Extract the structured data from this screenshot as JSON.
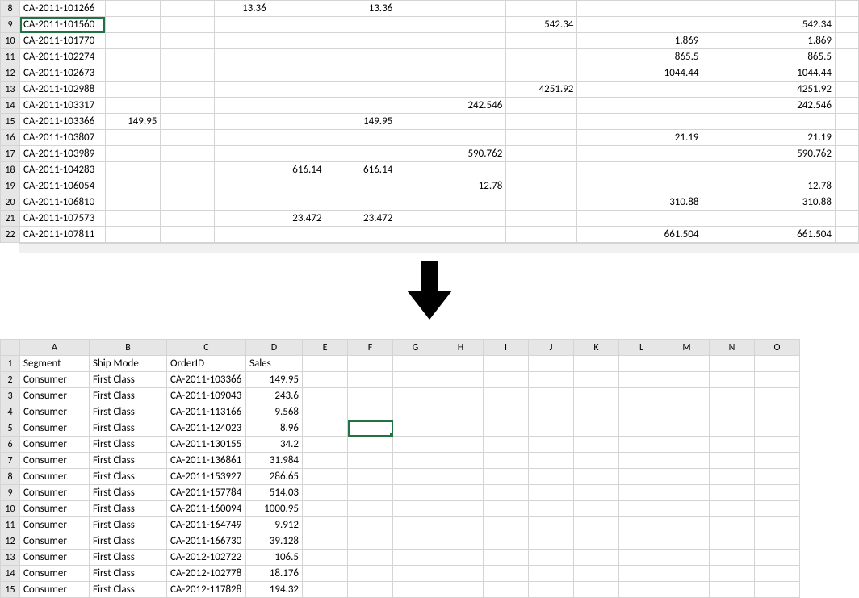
{
  "topSheet": {
    "selectedRow": 9,
    "rows": [
      {
        "r": 8,
        "id": "CA-2011-101266",
        "c3": "13.36",
        "c5": "13.36"
      },
      {
        "r": 9,
        "id": "CA-2011-101560",
        "c8": "542.34",
        "c12": "542.34"
      },
      {
        "r": 10,
        "id": "CA-2011-101770",
        "c10": "1.869",
        "c12": "1.869"
      },
      {
        "r": 11,
        "id": "CA-2011-102274",
        "c10": "865.5",
        "c12": "865.5"
      },
      {
        "r": 12,
        "id": "CA-2011-102673",
        "c10": "1044.44",
        "c12": "1044.44"
      },
      {
        "r": 13,
        "id": "CA-2011-102988",
        "c8": "4251.92",
        "c12": "4251.92"
      },
      {
        "r": 14,
        "id": "CA-2011-103317",
        "c7": "242.546",
        "c12": "242.546"
      },
      {
        "r": 15,
        "id": "CA-2011-103366",
        "c1": "149.95",
        "c5": "149.95"
      },
      {
        "r": 16,
        "id": "CA-2011-103807",
        "c10": "21.19",
        "c12": "21.19"
      },
      {
        "r": 17,
        "id": "CA-2011-103989",
        "c7": "590.762",
        "c12": "590.762"
      },
      {
        "r": 18,
        "id": "CA-2011-104283",
        "c4": "616.14",
        "c5": "616.14"
      },
      {
        "r": 19,
        "id": "CA-2011-106054",
        "c7": "12.78",
        "c12": "12.78"
      },
      {
        "r": 20,
        "id": "CA-2011-106810",
        "c10": "310.88",
        "c12": "310.88"
      },
      {
        "r": 21,
        "id": "CA-2011-107573",
        "c4": "23.472",
        "c5": "23.472"
      },
      {
        "r": 22,
        "id": "CA-2011-107811",
        "c10": "661.504",
        "c12": "661.504"
      }
    ]
  },
  "bottomSheet": {
    "columns": [
      "A",
      "B",
      "C",
      "D",
      "E",
      "F",
      "G",
      "H",
      "I",
      "J",
      "K",
      "L",
      "M",
      "N",
      "O"
    ],
    "headerRow": {
      "r": 1,
      "A": "Segment",
      "B": "Ship Mode",
      "C": "OrderID",
      "D": "Sales"
    },
    "selectedCell": {
      "row": 5,
      "col": "F"
    },
    "rows": [
      {
        "r": 2,
        "A": "Consumer",
        "B": "First Class",
        "C": "CA-2011-103366",
        "D": "149.95"
      },
      {
        "r": 3,
        "A": "Consumer",
        "B": "First Class",
        "C": "CA-2011-109043",
        "D": "243.6"
      },
      {
        "r": 4,
        "A": "Consumer",
        "B": "First Class",
        "C": "CA-2011-113166",
        "D": "9.568"
      },
      {
        "r": 5,
        "A": "Consumer",
        "B": "First Class",
        "C": "CA-2011-124023",
        "D": "8.96"
      },
      {
        "r": 6,
        "A": "Consumer",
        "B": "First Class",
        "C": "CA-2011-130155",
        "D": "34.2"
      },
      {
        "r": 7,
        "A": "Consumer",
        "B": "First Class",
        "C": "CA-2011-136861",
        "D": "31.984"
      },
      {
        "r": 8,
        "A": "Consumer",
        "B": "First Class",
        "C": "CA-2011-153927",
        "D": "286.65"
      },
      {
        "r": 9,
        "A": "Consumer",
        "B": "First Class",
        "C": "CA-2011-157784",
        "D": "514.03"
      },
      {
        "r": 10,
        "A": "Consumer",
        "B": "First Class",
        "C": "CA-2011-160094",
        "D": "1000.95"
      },
      {
        "r": 11,
        "A": "Consumer",
        "B": "First Class",
        "C": "CA-2011-164749",
        "D": "9.912"
      },
      {
        "r": 12,
        "A": "Consumer",
        "B": "First Class",
        "C": "CA-2011-166730",
        "D": "39.128"
      },
      {
        "r": 13,
        "A": "Consumer",
        "B": "First Class",
        "C": "CA-2012-102722",
        "D": "106.5"
      },
      {
        "r": 14,
        "A": "Consumer",
        "B": "First Class",
        "C": "CA-2012-102778",
        "D": "18.176"
      },
      {
        "r": 15,
        "A": "Consumer",
        "B": "First Class",
        "C": "CA-2012-117828",
        "D": "194.32"
      }
    ]
  }
}
